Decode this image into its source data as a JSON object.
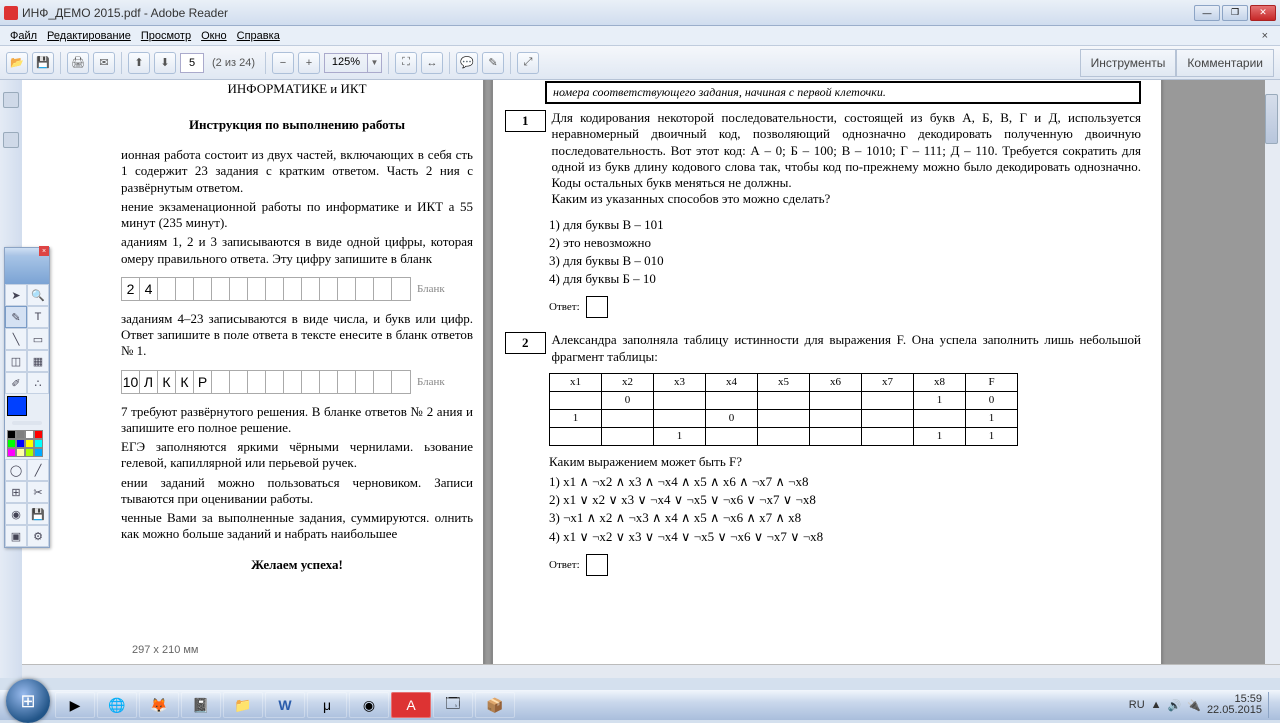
{
  "window": {
    "title": "ИНФ_ДЕМО 2015.pdf - Adobe Reader"
  },
  "menu": {
    "file": "Файл",
    "edit": "Редактирование",
    "view": "Просмотр",
    "window": "Окно",
    "help": "Справка",
    "closex": "×"
  },
  "toolbar": {
    "page_current": "5",
    "page_of": "(2 из 24)",
    "zoom": "125%",
    "tools": "Инструменты",
    "comments": "Комментарии"
  },
  "leftPage": {
    "title1": "ИНФОРМАТИКЕ и ИКТ",
    "title2": "Инструкция по выполнению работы",
    "p1": "ионная работа состоит из двух частей, включающих в себя сть 1 содержит 23 задания с кратким ответом. Часть 2 ния с развёрнутым ответом.",
    "p2": "нение экзаменационной работы по информатике и ИКТ а 55 минут (235 минут).",
    "p3": "аданиям 1, 2 и 3 записываются в виде одной цифры, которая омеру правильного ответа. Эту цифру запишите в бланк",
    "grid1": [
      "2",
      "4",
      "",
      "",
      "",
      "",
      "",
      "",
      "",
      "",
      "",
      "",
      "",
      "",
      "",
      ""
    ],
    "blank": "Бланк",
    "p4": "заданиям 4–23 записываются в виде числа, и букв или цифр. Ответ запишите в поле ответа в тексте енесите в бланк ответов № 1.",
    "grid2": [
      "10",
      "Л",
      "К",
      "К",
      "Р",
      "",
      "",
      "",
      "",
      "",
      "",
      "",
      "",
      "",
      "",
      ""
    ],
    "p5": "7 требуют развёрнутого решения. В бланке ответов № 2 ания и запишите его полное решение.",
    "p6": "ЕГЭ заполняются яркими чёрными чернилами. ьзование гелевой, капиллярной или перьевой ручек.",
    "p7": "ении заданий можно пользоваться черновиком. Записи тываются при оценивании работы.",
    "p8": "ченные Вами за выполненные задания, суммируются. олнить как можно больше заданий и набрать наибольшее",
    "wish": "Желаем успеха!",
    "dim": "297 x 210 мм"
  },
  "rightPage": {
    "banner": "номера соответствующего задания, начиная с первой клеточки.",
    "q1": {
      "num": "1",
      "text": "Для кодирования некоторой последовательности, состоящей из букв А, Б, В, Г и Д, используется неравномерный двоичный код, позволяющий однозначно декодировать полученную двоичную последовательность. Вот этот код: А – 0; Б – 100; В – 1010; Г – 111; Д – 110. Требуется сократить для одной из букв длину кодового слова так, чтобы код по-прежнему можно было декодировать однозначно. Коды остальных букв меняться не должны.\nКаким из указанных способов это можно сделать?",
      "opts": [
        "1)  для буквы В – 101",
        "2)  это невозможно",
        "3)  для буквы В – 010",
        "4)  для буквы Б – 10"
      ],
      "answer": "Ответ:"
    },
    "q2": {
      "num": "2",
      "text": "Александра заполняла таблицу истинности для выражения F. Она успела заполнить лишь небольшой фрагмент таблицы:",
      "headers": [
        "x1",
        "x2",
        "x3",
        "x4",
        "x5",
        "x6",
        "x7",
        "x8",
        "F"
      ],
      "rows": [
        [
          "",
          "0",
          "",
          "",
          "",
          "",
          "",
          "1",
          "0"
        ],
        [
          "1",
          "",
          "",
          "0",
          "",
          "",
          "",
          "",
          "1"
        ],
        [
          "",
          "",
          "1",
          "",
          "",
          "",
          "",
          "1",
          "1"
        ]
      ],
      "follow": "Каким выражением может быть F?",
      "opts": [
        "1)  x1 ∧ ¬x2 ∧ x3 ∧ ¬x4 ∧ x5 ∧ x6 ∧ ¬x7 ∧ ¬x8",
        "2)  x1 ∨ x2 ∨ x3 ∨ ¬x4 ∨ ¬x5 ∨ ¬x6 ∨ ¬x7 ∨ ¬x8",
        "3)  ¬x1 ∧ x2 ∧ ¬x3 ∧ x4 ∧ x5 ∧ ¬x6 ∧ x7 ∧ x8",
        "4)  x1 ∨ ¬x2 ∨ x3 ∨ ¬x4 ∨ ¬x5 ∨ ¬x6 ∨ ¬x7 ∨ ¬x8"
      ],
      "answer": "Ответ:"
    }
  },
  "tray": {
    "lang": "RU",
    "time": "15:59",
    "date": "22.05.2015"
  },
  "colors": {
    "palette": [
      "#000",
      "#7f7f7f",
      "#fff",
      "#f00",
      "#0f0",
      "#00f",
      "#ff0",
      "#0ff",
      "#f0f",
      "#ffa",
      "#af0",
      "#0af"
    ]
  }
}
